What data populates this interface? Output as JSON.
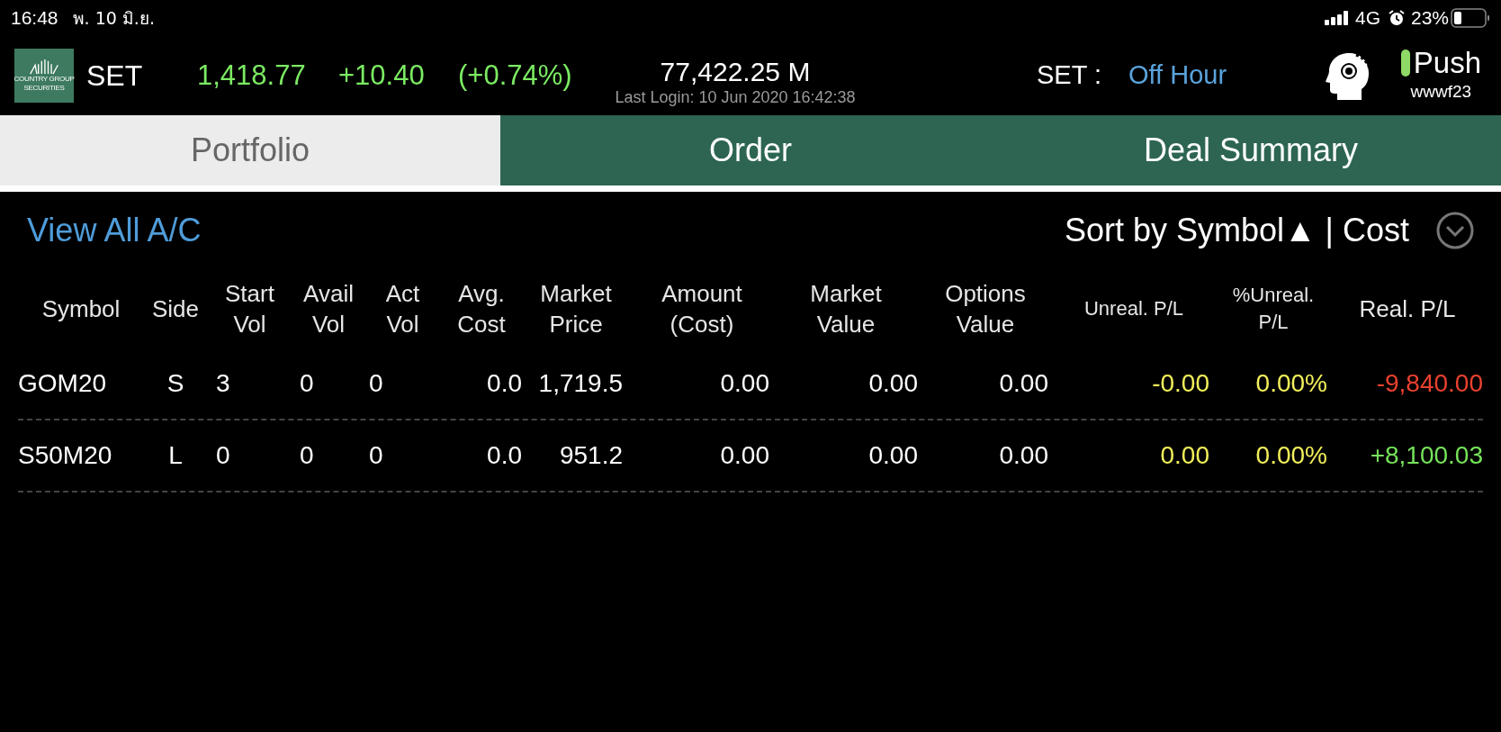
{
  "status_bar": {
    "time": "16:48",
    "date": "พ. 10 มิ.ย.",
    "network": "4G",
    "battery": "23%"
  },
  "header": {
    "logo_lines": [
      "COUNTRY GROUP",
      "SECURITIES"
    ],
    "market": "SET",
    "index": "1,418.77",
    "change": "+10.40",
    "change_pct": "(+0.74%)",
    "volume": "77,422.25 M",
    "last_login": "Last Login: 10 Jun 2020 16:42:38",
    "session_label": "SET :",
    "session": "Off Hour",
    "push": {
      "label": "Push",
      "on": true
    },
    "user": "wwwf23"
  },
  "tabs": [
    {
      "label": "Portfolio",
      "selected": true
    },
    {
      "label": "Order",
      "selected": false
    },
    {
      "label": "Deal Summary",
      "selected": false
    }
  ],
  "toolbar": {
    "view_all": "View All A/C",
    "sort": "Sort by Symbol▲ | Cost"
  },
  "table": {
    "columns": [
      "Symbol",
      "Side",
      "Start\nVol",
      "Avail\nVol",
      "Act\nVol",
      "Avg.\nCost",
      "Market\nPrice",
      "Amount\n(Cost)",
      "Market\nValue",
      "Options\nValue",
      "Unreal. P/L",
      "%Unreal.\nP/L",
      "Real. P/L"
    ],
    "rows": [
      {
        "cells": [
          {
            "text": "GOM20"
          },
          {
            "text": "S"
          },
          {
            "text": "3"
          },
          {
            "text": "0"
          },
          {
            "text": "0"
          },
          {
            "text": "0.0"
          },
          {
            "text": "1,719.5"
          },
          {
            "text": "0.00"
          },
          {
            "text": "0.00"
          },
          {
            "text": "0.00"
          },
          {
            "text": "-0.00",
            "color": "#f2f05a"
          },
          {
            "text": "0.00%",
            "color": "#f2f05a"
          },
          {
            "text": "-9,840.00",
            "color": "#e9412f"
          }
        ]
      },
      {
        "cells": [
          {
            "text": "S50M20"
          },
          {
            "text": "L"
          },
          {
            "text": "0"
          },
          {
            "text": "0"
          },
          {
            "text": "0"
          },
          {
            "text": "0.0"
          },
          {
            "text": "951.2"
          },
          {
            "text": "0.00"
          },
          {
            "text": "0.00"
          },
          {
            "text": "0.00"
          },
          {
            "text": "0.00",
            "color": "#f2f05a"
          },
          {
            "text": "0.00%",
            "color": "#f2f05a"
          },
          {
            "text": "+8,100.03",
            "color": "#76e35a"
          }
        ]
      }
    ]
  }
}
